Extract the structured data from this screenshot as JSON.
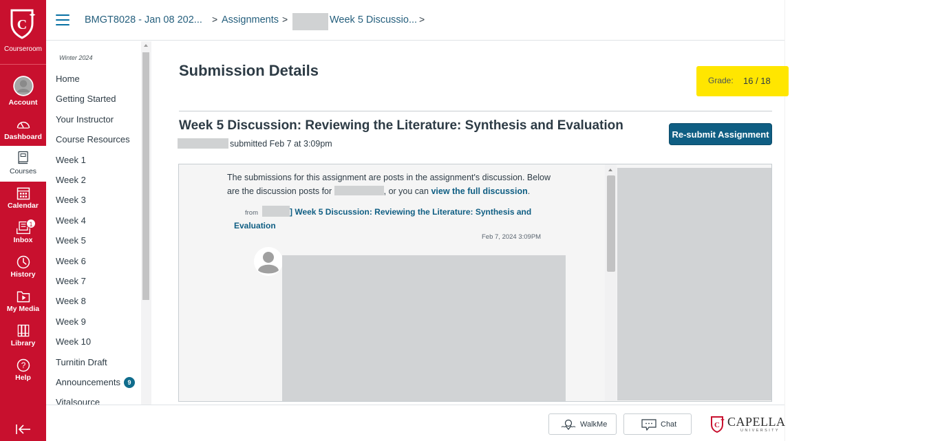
{
  "global_nav": {
    "logo_label": "Courseroom",
    "items": [
      {
        "label": "Account",
        "icon": "account-avatar-icon"
      },
      {
        "label": "Dashboard",
        "icon": "dashboard-gauge-icon"
      },
      {
        "label": "Courses",
        "icon": "courses-book-icon",
        "active": true
      },
      {
        "label": "Calendar",
        "icon": "calendar-icon"
      },
      {
        "label": "Inbox",
        "icon": "inbox-icon",
        "badge": "1"
      },
      {
        "label": "History",
        "icon": "history-clock-icon"
      },
      {
        "label": "My Media",
        "icon": "my-media-folder-icon"
      },
      {
        "label": "Library",
        "icon": "library-books-icon"
      },
      {
        "label": "Help",
        "icon": "help-question-icon"
      }
    ],
    "collapse_icon": "collapse-arrow-icon"
  },
  "breadcrumb": {
    "items": [
      "BMGT8028 - Jan 08 202...",
      "Assignments",
      "Week 5 Discussio..."
    ],
    "separator": ">"
  },
  "course_nav": {
    "term": "Winter 2024",
    "items": [
      {
        "label": "Home"
      },
      {
        "label": "Getting Started"
      },
      {
        "label": "Your Instructor"
      },
      {
        "label": "Course Resources"
      },
      {
        "label": "Week 1"
      },
      {
        "label": "Week 2"
      },
      {
        "label": "Week 3"
      },
      {
        "label": "Week 4"
      },
      {
        "label": "Week 5"
      },
      {
        "label": "Week 6"
      },
      {
        "label": "Week 7"
      },
      {
        "label": "Week 8"
      },
      {
        "label": "Week 9"
      },
      {
        "label": "Week 10"
      },
      {
        "label": "Turnitin Draft"
      },
      {
        "label": "Announcements",
        "badge": "9"
      },
      {
        "label": "Vitalsource"
      }
    ]
  },
  "main": {
    "title": "Submission Details",
    "grade": {
      "label": "Grade:",
      "value": "16 / 18",
      "score": 16,
      "out_of": 18,
      "highlight_color": "#ffe600"
    },
    "assignment_title": "Week 5 Discussion: Reviewing the Literature: Synthesis and Evaluation",
    "submitted_text": "submitted Feb 7 at 3:09pm",
    "resubmit_label": "Re-submit Assignment",
    "discussion": {
      "intro_part1": "The submissions for this assignment are posts in the assignment's discussion. Below are the discussion posts for ",
      "intro_part2": ", or you can ",
      "full_discussion_link": "view the full discussion",
      "intro_end": ".",
      "from_label": "from",
      "from_link": "] Week 5 Discussion: Reviewing the Literature: Synthesis and Evaluation",
      "post_time": "Feb 7, 2024 3:09PM"
    }
  },
  "footer": {
    "walkme_label": "WalkMe",
    "chat_label": "Chat",
    "brand_name": "CAPELLA",
    "brand_sub": "UNIVERSITY"
  },
  "colors": {
    "brand_red": "#c8102e",
    "primary_button": "#0f5e83",
    "link": "#0f5e83",
    "badge": "#0f6c8c"
  }
}
